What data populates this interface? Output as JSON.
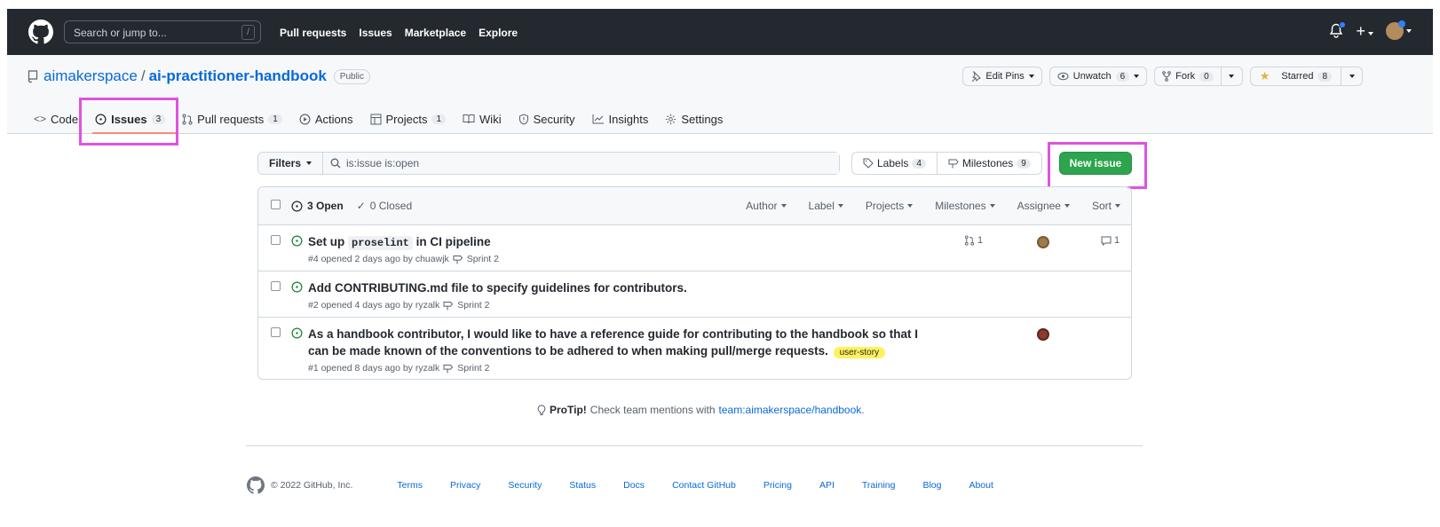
{
  "topbar": {
    "search_placeholder": "Search or jump to...",
    "search_shortcut": "/",
    "nav": [
      "Pull requests",
      "Issues",
      "Marketplace",
      "Explore"
    ]
  },
  "repo": {
    "owner": "aimakerspace",
    "separator": "/",
    "name": "ai-practitioner-handbook",
    "visibility": "Public",
    "edit_pins": "Edit Pins",
    "unwatch": "Unwatch",
    "watch_count": "6",
    "fork": "Fork",
    "fork_count": "0",
    "starred": "Starred",
    "star_count": "8"
  },
  "tabs": [
    {
      "label": "Code"
    },
    {
      "label": "Issues",
      "count": "3"
    },
    {
      "label": "Pull requests",
      "count": "1"
    },
    {
      "label": "Actions"
    },
    {
      "label": "Projects",
      "count": "1"
    },
    {
      "label": "Wiki"
    },
    {
      "label": "Security"
    },
    {
      "label": "Insights"
    },
    {
      "label": "Settings"
    }
  ],
  "toolbar": {
    "filters": "Filters",
    "query": "is:issue is:open",
    "labels": "Labels",
    "labels_count": "4",
    "milestones": "Milestones",
    "milestones_count": "9",
    "new_issue": "New issue"
  },
  "list_header": {
    "open": "3 Open",
    "closed": "0 Closed",
    "filters": [
      "Author",
      "Label",
      "Projects",
      "Milestones",
      "Assignee",
      "Sort"
    ]
  },
  "issues": [
    {
      "title_pre": "Set up",
      "title_code": "proselint",
      "title_post": "in CI pipeline",
      "meta": "#4 opened 2 days ago by chuawjk",
      "milestone": "Sprint 2",
      "pr_count": "1",
      "comments": "1"
    },
    {
      "title": "Add CONTRIBUTING.md file to specify guidelines for contributors.",
      "meta": "#2 opened 4 days ago by ryzalk",
      "milestone": "Sprint 2"
    },
    {
      "title": "As a handbook contributor, I would like to have a reference guide for contributing to the handbook so that I can be made known of the conventions to be adhered to when making pull/merge requests.",
      "label": "user-story",
      "meta": "#1 opened 8 days ago by ryzalk",
      "milestone": "Sprint 2"
    }
  ],
  "protip": {
    "bold": "ProTip!",
    "text": "Check team mentions with",
    "link": "team:aimakerspace/handbook",
    "end": "."
  },
  "footer": {
    "copyright": "© 2022 GitHub, Inc.",
    "links": [
      "Terms",
      "Privacy",
      "Security",
      "Status",
      "Docs",
      "Contact GitHub",
      "Pricing",
      "API",
      "Training",
      "Blog",
      "About"
    ]
  },
  "colors": {
    "topbar": "#24292f",
    "link": "#0969da",
    "new_issue": "#2da44e",
    "open_icon": "#1a7f37",
    "highlight": "#e052e0",
    "tab_underline": "#fd8c73"
  }
}
